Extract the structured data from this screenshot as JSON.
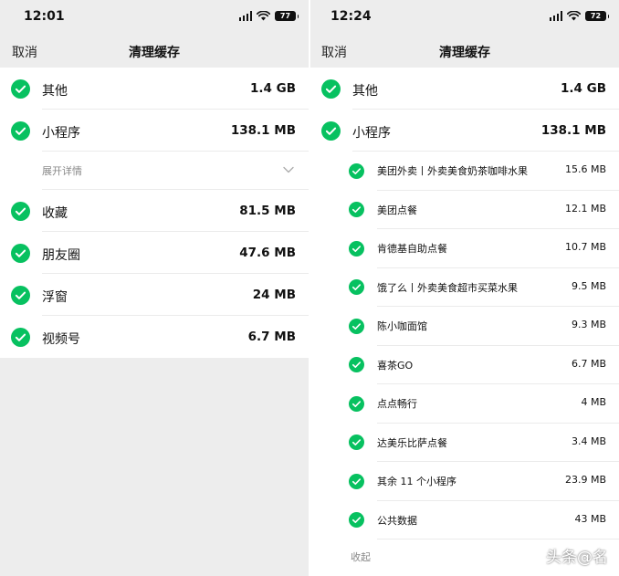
{
  "left": {
    "status": {
      "time": "12:01",
      "battery": "77"
    },
    "nav": {
      "cancel": "取消",
      "title": "清理缓存"
    },
    "items": [
      {
        "label": "其他",
        "size": "1.4 GB"
      },
      {
        "label": "小程序",
        "size": "138.1 MB"
      }
    ],
    "expand_label": "展开详情",
    "items2": [
      {
        "label": "收藏",
        "size": "81.5 MB"
      },
      {
        "label": "朋友圈",
        "size": "47.6 MB"
      },
      {
        "label": "浮窗",
        "size": "24 MB"
      },
      {
        "label": "视频号",
        "size": "6.7 MB"
      }
    ]
  },
  "right": {
    "status": {
      "time": "12:24",
      "battery": "72"
    },
    "nav": {
      "cancel": "取消",
      "title": "清理缓存"
    },
    "items": [
      {
        "label": "其他",
        "size": "1.4 GB"
      },
      {
        "label": "小程序",
        "size": "138.1 MB"
      }
    ],
    "subitems": [
      {
        "label": "美团外卖丨外卖美食奶茶咖啡水果",
        "size": "15.6 MB"
      },
      {
        "label": "美团点餐",
        "size": "12.1 MB"
      },
      {
        "label": "肯德基自助点餐",
        "size": "10.7 MB"
      },
      {
        "label": "饿了么丨外卖美食超市买菜水果",
        "size": "9.5 MB"
      },
      {
        "label": "陈小咖面馆",
        "size": "9.3 MB"
      },
      {
        "label": "喜茶GO",
        "size": "6.7 MB"
      },
      {
        "label": "点点畅行",
        "size": "4 MB"
      },
      {
        "label": "达美乐比萨点餐",
        "size": "3.4 MB"
      },
      {
        "label": "其余 11 个小程序",
        "size": "23.9 MB"
      },
      {
        "label": "公共数据",
        "size": "43 MB"
      }
    ],
    "collapse_label": "收起"
  },
  "watermark": "头条@名",
  "colors": {
    "check": "#07c160",
    "background": "#ededed",
    "row": "#ffffff"
  }
}
